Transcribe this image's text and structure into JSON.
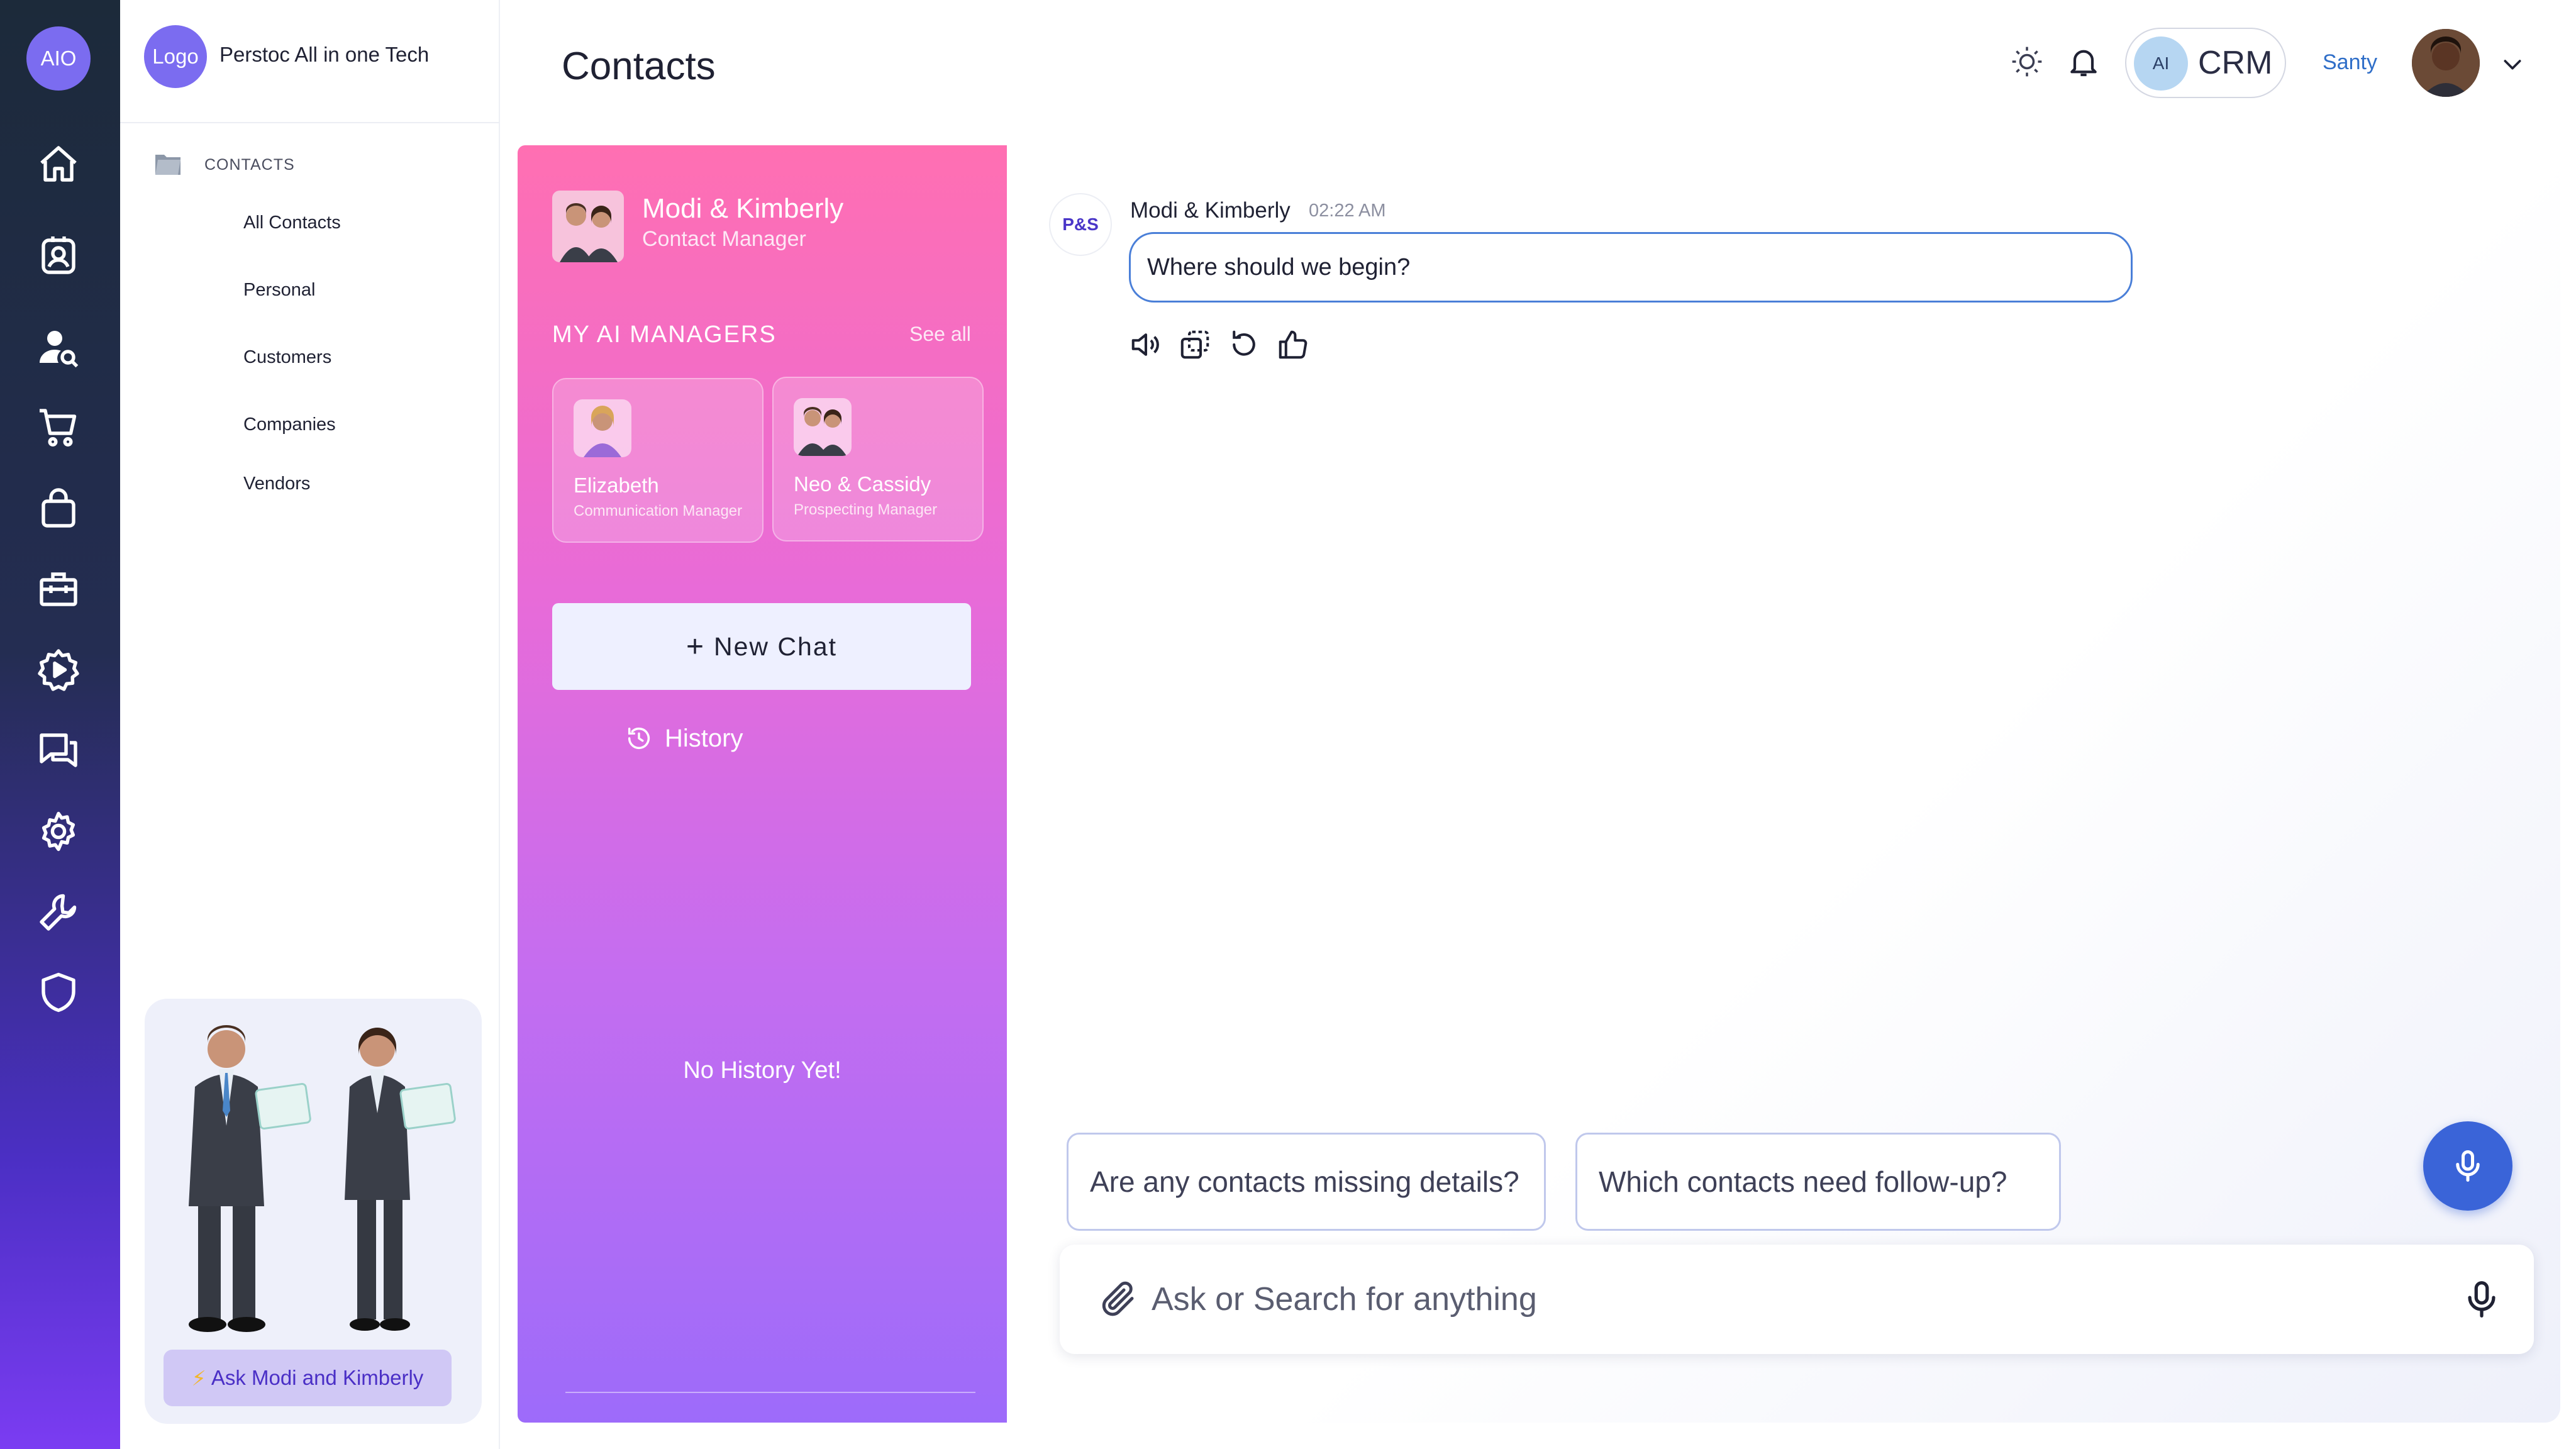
{
  "rail": {
    "logo": "AIO",
    "icons": [
      "home-icon",
      "contact-badge-icon",
      "user-search-icon",
      "cart-icon",
      "shopping-bag-icon",
      "briefcase-icon",
      "cog-play-icon",
      "chat-icon",
      "settings-icon",
      "wrench-icon",
      "shield-icon"
    ]
  },
  "sidebar": {
    "org_logo": "Logo",
    "org_name": "Perstoc All in one Tech",
    "section": "CONTACTS",
    "items": [
      "All Contacts",
      "Personal",
      "Customers",
      "Companies",
      "Vendors"
    ],
    "promo_button": "Ask Modi and Kimberly"
  },
  "header": {
    "title": "Contacts",
    "crm_badge": "AI",
    "crm_label": "CRM",
    "user_name": "Santy"
  },
  "panel": {
    "manager_name": "Modi & Kimberly",
    "manager_role": "Contact Manager",
    "section_title": "MY AI MANAGERS",
    "see_all": "See all",
    "managers": [
      {
        "name": "Elizabeth",
        "role": "Communication Manager"
      },
      {
        "name": "Neo & Cassidy",
        "role": "Prospecting Manager"
      }
    ],
    "new_chat": "New Chat",
    "history": "History",
    "empty_history": "No History Yet!"
  },
  "chat": {
    "badge": "P&S",
    "author": "Modi & Kimberly",
    "time": "02:22 AM",
    "message": "Where should we begin?",
    "suggestions": [
      "Are any contacts missing details?",
      "Which contacts need follow-up?"
    ],
    "search_placeholder": "Ask or Search for anything"
  },
  "colors": {
    "accent": "#3a64d8",
    "panel_top": "#ff6fb2",
    "panel_bottom": "#9d6bfa",
    "rail_top": "#1c2a3a",
    "rail_bottom": "#7b3cf2"
  }
}
